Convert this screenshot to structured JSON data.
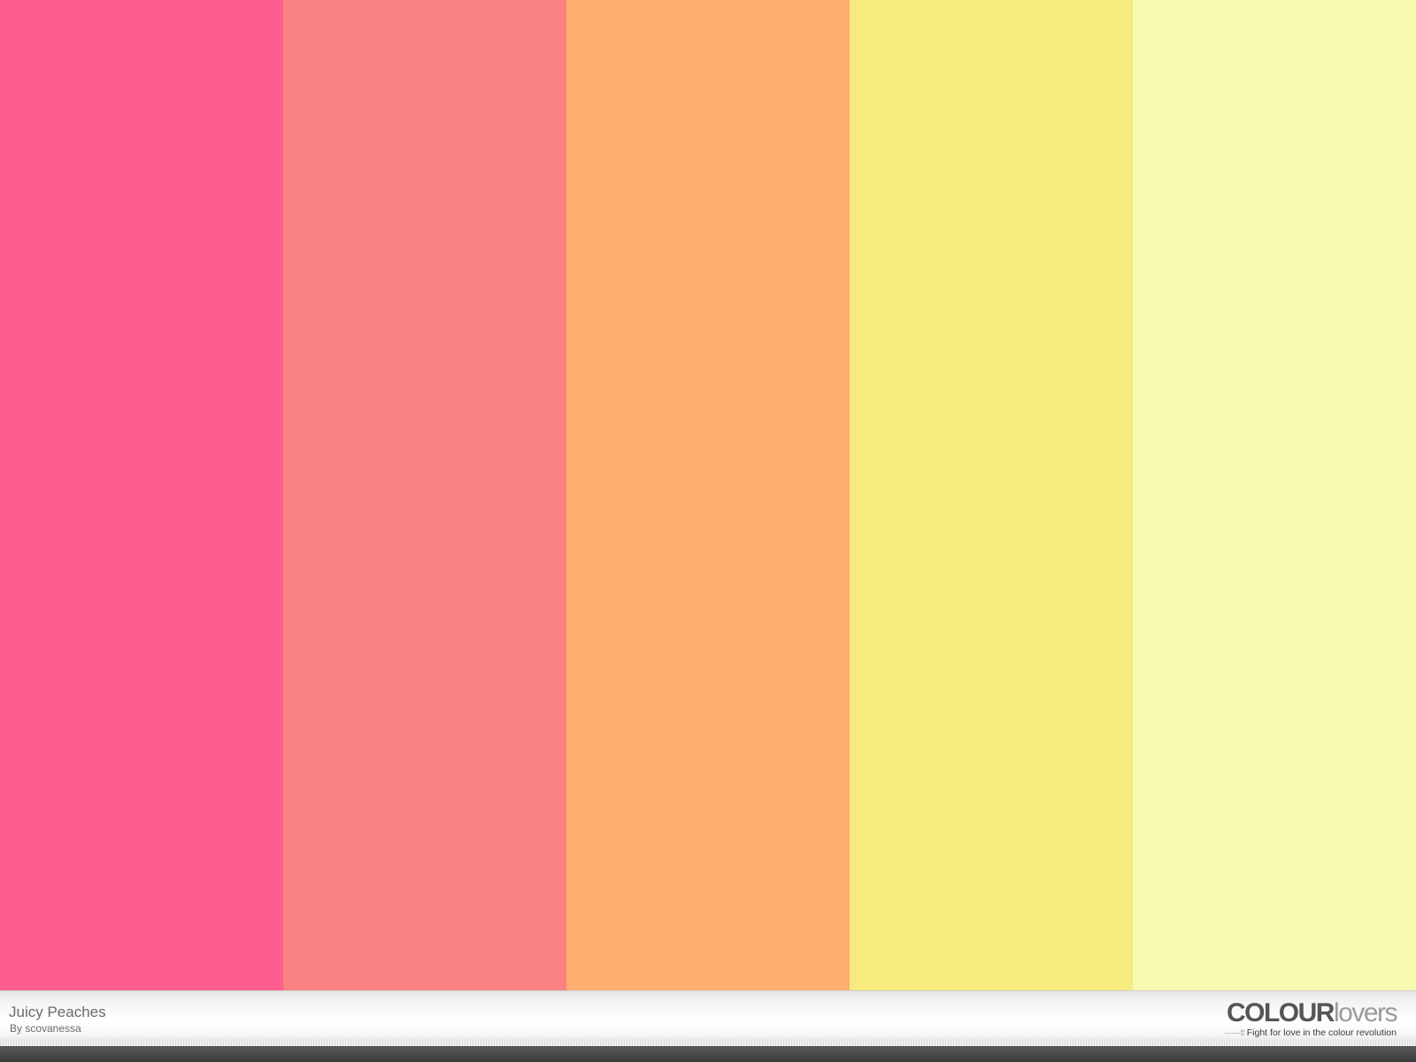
{
  "palette": {
    "title": "Juicy Peaches",
    "author": "By scovanessa",
    "colors": [
      "#fe5e8f",
      "#fa8282",
      "#feae70",
      "#f7ea7e",
      "#f8f9b1"
    ]
  },
  "brand": {
    "logo_strong": "COLOUR",
    "logo_light": "lovers",
    "tagline": "Fight for love in the colour revolution",
    "tagline_dots": "·········⁞⁞⁞"
  }
}
